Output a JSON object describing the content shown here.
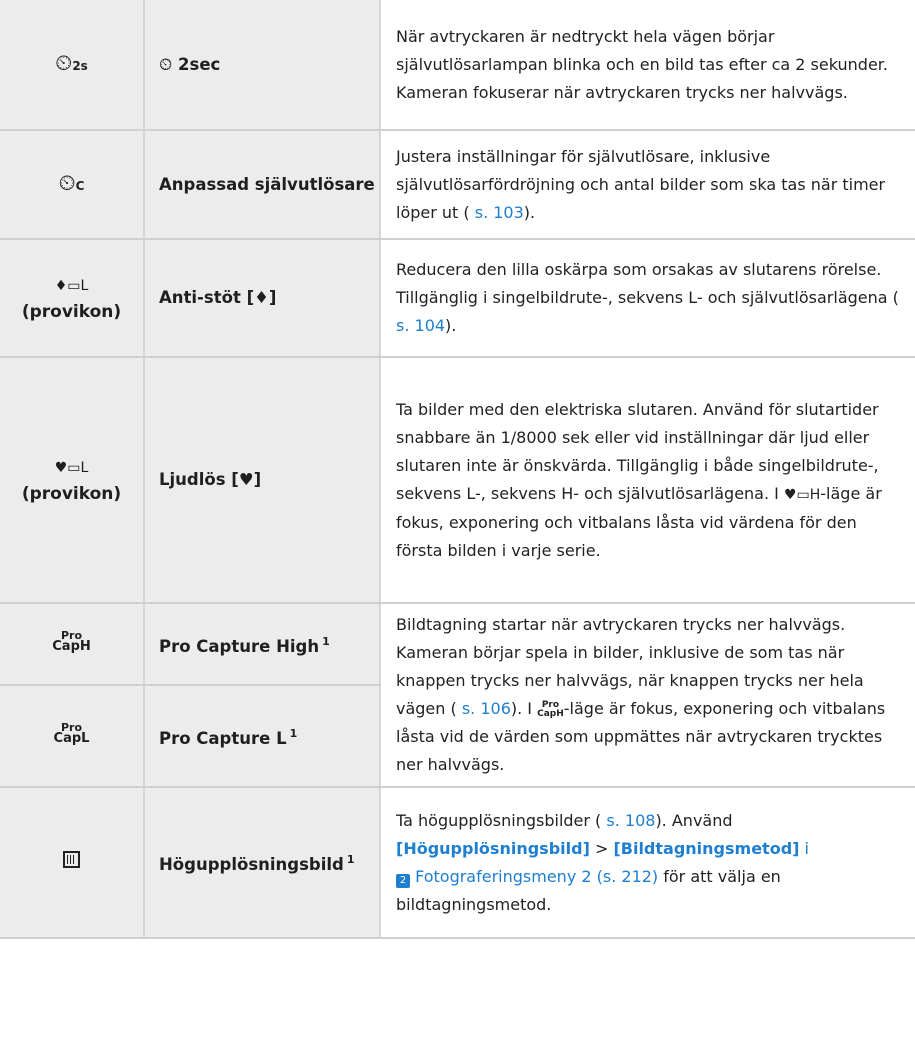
{
  "rows": [
    {
      "symbol": "◌",
      "symbol_sub": "2s",
      "name_symbol": "ⓢ",
      "name": "2sec",
      "desc": "När avtryckaren är nedtryckt hela vägen börjar självutlösarlampan blinka och en bild tas efter ca 2 sekunder. Kameran fokuserar när avtryckaren trycks ner halvvägs."
    },
    {
      "symbol": "◌",
      "symbol_sub": "C",
      "name": "Anpassad självutlösare",
      "desc_a": "Justera inställningar för självutlösare, inklusive självutlösarfördröjning och antal bilder som ska tas när timer löper ut (",
      "desc_link": " s. 103",
      "desc_b": ")."
    },
    {
      "symbol": "♦▭L",
      "symbol_note": "(provikon)",
      "name": "Anti-stöt [♦]",
      "desc_a": "Reducera den lilla oskärpa som orsakas av slutarens rörelse. Tillgänglig i singelbildrute-, sekvens L- och självutlösarlägena (",
      "desc_link": " s. 104",
      "desc_b": ")."
    },
    {
      "symbol": "♥▭L",
      "symbol_note": "(provikon)",
      "name": "Ljudlös [♥]",
      "desc_a": "Ta bilder med den elektriska slutaren. Använd för slutartider snabbare än 1/8000 sek eller vid inställningar där ljud eller slutaren inte är önskvärda. Tillgänglig i både singelbildrute-, sekvens L-, sekvens H- och självutlösarlägena. I ",
      "desc_icon": "♥▭H",
      "desc_b": "-läge är fokus, exponering och vitbalans låsta vid värdena för den första bilden i varje serie."
    },
    {
      "symbol_top": "Pro",
      "symbol_bottom": "CapH",
      "name": "Pro Capture High",
      "sup": "1"
    },
    {
      "symbol_top": "Pro",
      "symbol_bottom": "CapL",
      "name": "Pro Capture L",
      "sup": "1"
    },
    {
      "symbol": "hires",
      "name": "Högupplösningsbild",
      "sup": "1",
      "desc_a": "Ta högupplösningsbilder (",
      "desc_link": " s. 108",
      "desc_b": "). Använd ",
      "desc_bold1": "[Högupplösningsbild]",
      "desc_gt": " > ",
      "desc_bold2": "[Bildtagningsmetod]",
      "desc_i": " i",
      "desc_menu_icon": "2",
      "desc_link2": " Fotograferingsmeny 2 (s. 212)",
      "desc_c": " för att välja en bildtagningsmetod."
    }
  ],
  "procap_desc": {
    "a": "Bildtagning startar när avtryckaren trycks ner halvvägs. Kameran börjar spela in bilder, inklusive de som tas när knappen trycks ner halvvägs, när knappen trycks ner hela vägen (",
    "link": " s. 106",
    "b": "). I ",
    "icon_top": "Pro",
    "icon_bottom": "CapH",
    "c": "-läge är fokus, exponering och vitbalans låsta vid de värden som uppmättes när avtryckaren trycktes ner halvvägs."
  },
  "colors": {
    "link": "#1e7fd0",
    "label_bg": "#ececec"
  }
}
